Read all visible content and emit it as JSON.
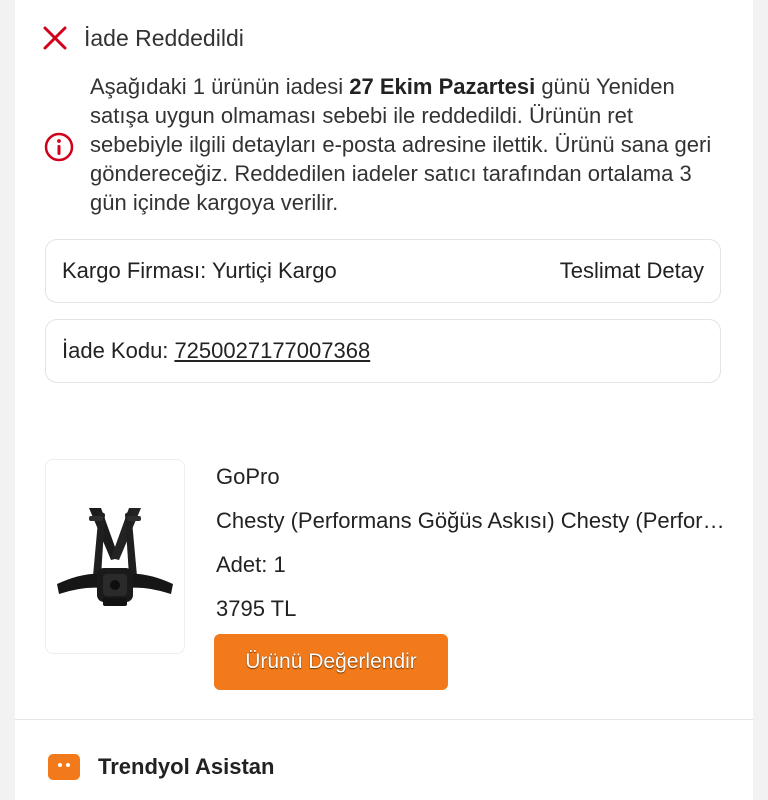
{
  "status": {
    "icon": "close-icon",
    "title": "İade Reddedildi",
    "color": "#d0021b"
  },
  "message": {
    "icon": "info-icon",
    "part1": "Aşağıdaki 1 ürünün iadesi ",
    "date": "27 Ekim Pazartesi",
    "part2": " günü Yeniden satışa uygun olmaması sebebi ile reddedildi. Ürünün ret sebebiyle ilgili detayları e-posta adresine ilettik. Ürünü sana geri göndereceğiz. Reddedilen iadeler satıcı tarafından ortalama 3 gün içinde kargoya verilir."
  },
  "cargo": {
    "label": "Kargo Firması: Yurtiçi Kargo",
    "detail_link": "Teslimat Detay"
  },
  "return_code": {
    "label": "İade Kodu:",
    "value": "7250027177007368"
  },
  "product": {
    "brand": "GoPro",
    "name": "Chesty (Performans Göğüs Askısı)  Chesty (Performans Göğüs Askısı)",
    "quantity": "Adet: 1",
    "price": "3795 TL",
    "image_icon": "chest-harness-image",
    "rate_button": "Ürünü Değerlendir"
  },
  "assistant": {
    "label": "Trendyol Asistan"
  },
  "colors": {
    "accent": "#f27a1a",
    "error": "#d0021b"
  }
}
